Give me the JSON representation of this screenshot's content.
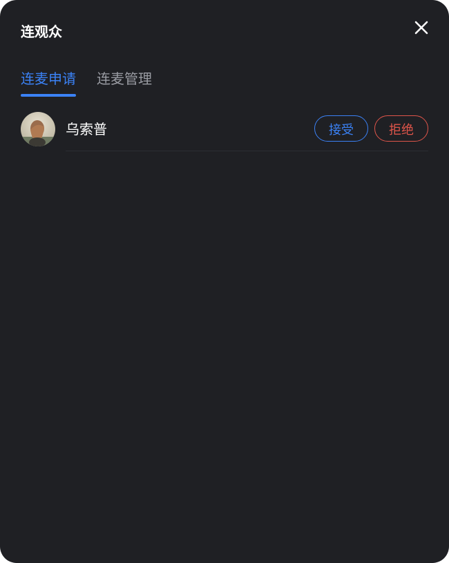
{
  "dialog": {
    "title": "连观众"
  },
  "tabs": [
    {
      "label": "连麦申请",
      "active": true
    },
    {
      "label": "连麦管理",
      "active": false
    }
  ],
  "requests": [
    {
      "name": "乌索普",
      "accept_label": "接受",
      "reject_label": "拒绝"
    }
  ],
  "colors": {
    "background": "#1f2024",
    "accent": "#3b82f6",
    "danger": "#e0554a",
    "text": "#ffffff",
    "muted": "#9a9ca3"
  },
  "icons": {
    "close": "close-icon",
    "avatar": "user-avatar"
  }
}
